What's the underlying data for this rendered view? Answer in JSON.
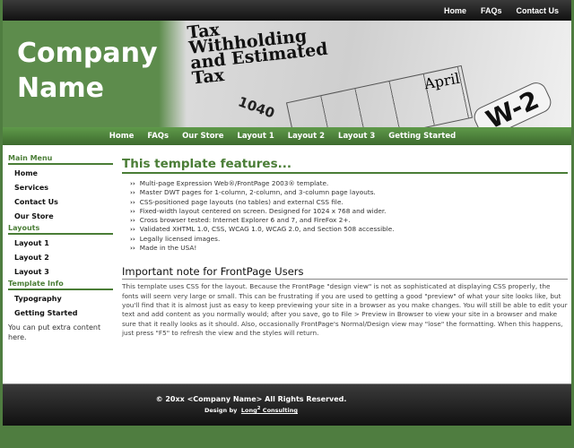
{
  "topnav": [
    "Home",
    "FAQs",
    "Contact Us"
  ],
  "header": {
    "company_line1": "Company",
    "company_line2": "Name",
    "image_text": [
      "Tax",
      "Withholding",
      "and Estimated",
      "Tax"
    ],
    "april": "April",
    "form1040": "1040",
    "w2": "W-2"
  },
  "nav": [
    "Home",
    "FAQs",
    "Our Store",
    "Layout 1",
    "Layout 2",
    "Layout 3",
    "Getting Started"
  ],
  "sidebar": {
    "main_menu": {
      "title": "Main Menu",
      "items": [
        "Home",
        "Services",
        "Contact Us",
        "Our Store"
      ]
    },
    "layouts": {
      "title": "Layouts",
      "items": [
        "Layout 1",
        "Layout 2",
        "Layout 3"
      ]
    },
    "template_info": {
      "title": "Template Info",
      "items": [
        "Typography",
        "Getting Started"
      ]
    },
    "extra": "You can put extra content here."
  },
  "main": {
    "heading": "This template features...",
    "bullet": "››",
    "features": [
      "Multi-page Expression Web®/FrontPage 2003® template.",
      "Master DWT pages for 1-column, 2-column, and 3-column page layouts.",
      "CSS-positioned page layouts (no tables) and external CSS file.",
      "Fixed-width layout centered on screen. Designed for 1024 x 768 and wider.",
      "Cross browser tested: Internet Explorer 6 and 7, and FireFox 2+.",
      "Validated XHTML 1.0, CSS, WCAG 1.0, WCAG 2.0, and Section 508 accessible.",
      "Legally licensed images.",
      "Made in the USA!"
    ],
    "note_heading": "Important note for FrontPage Users",
    "note": "This template uses CSS for the layout. Because the FrontPage \"design view\" is not as sophisticated at displaying CSS properly, the fonts will seem very large or small. This can be frustrating if you are used to getting a good \"preview\" of what your site looks like, but you'll find that it is almost just as easy to keep previewing your site in a browser as you make changes. You will still be able to edit your text and add content as you normally would; after you save, go to File > Preview in Browser to view your site in a browser and make sure that it really looks as it should. Also, occasionally FrontPage's Normal/Design view may \"lose\" the formatting. When this happens, just press \"F5\" to refresh the view and the styles will return."
  },
  "footer": {
    "copyright": "© 20xx <Company Name> All Rights Reserved.",
    "design_by": "Design by",
    "link_pre": "Long",
    "link_sup": "2",
    "link_post": " Consulting"
  },
  "colors": {
    "green": "#4a7d36",
    "dark": "#1a1a1a"
  }
}
